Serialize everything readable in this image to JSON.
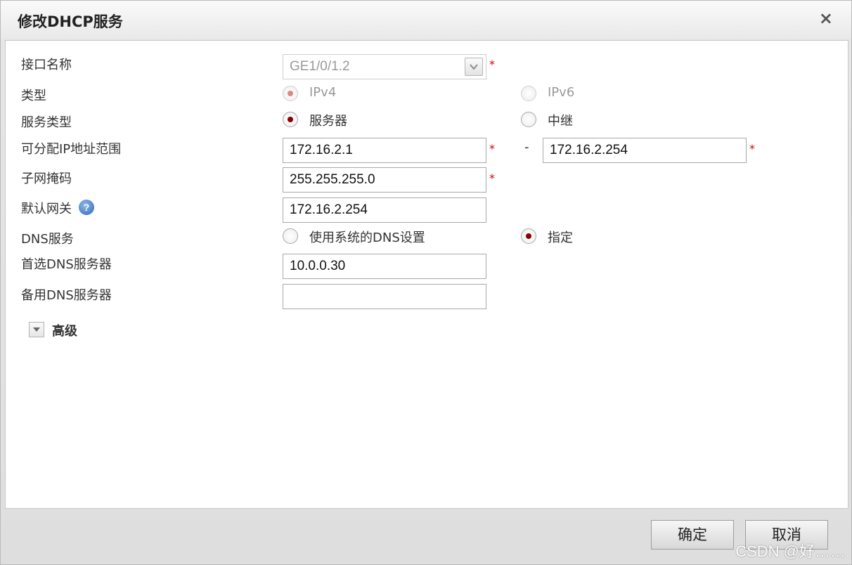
{
  "dialog": {
    "title": "修改DHCP服务",
    "close": "×"
  },
  "form": {
    "interface_label": "接口名称",
    "interface_value": "GE1/0/1.2",
    "type_label": "类型",
    "type_options": [
      "IPv4",
      "IPv6"
    ],
    "type_selected": "IPv4",
    "service_type_label": "服务类型",
    "service_type_options": [
      "服务器",
      "中继"
    ],
    "service_type_selected": "服务器",
    "ip_range_label": "可分配IP地址范围",
    "ip_range_start": "172.16.2.1",
    "ip_range_separator": "-",
    "ip_range_end": "172.16.2.254",
    "subnet_mask_label": "子网掩码",
    "subnet_mask_value": "255.255.255.0",
    "gateway_label": "默认网关",
    "gateway_value": "172.16.2.254",
    "help_glyph": "?",
    "dns_label": "DNS服务",
    "dns_options": [
      "使用系统的DNS设置",
      "指定"
    ],
    "dns_selected": "指定",
    "primary_dns_label": "首选DNS服务器",
    "primary_dns_value": "10.0.0.30",
    "backup_dns_label": "备用DNS服务器",
    "backup_dns_value": "",
    "required_mark": "*",
    "advanced_label": "高级"
  },
  "footer": {
    "confirm_label": "确定",
    "cancel_label": "取消"
  },
  "watermark": "CSDN @好……",
  "colors": {
    "radio_selected": "#8b0000",
    "required": "#d40000"
  }
}
